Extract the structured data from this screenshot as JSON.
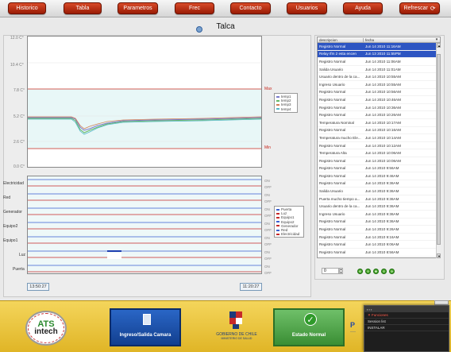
{
  "nav": {
    "buttons": [
      {
        "label": "Historico"
      },
      {
        "label": "Tabla"
      },
      {
        "label": "Parametros"
      },
      {
        "label": "Frec"
      },
      {
        "label": "Contacto"
      },
      {
        "label": "Usuarios"
      },
      {
        "label": "Ayuda"
      },
      {
        "label": "Refrescar",
        "icon": "refresh-icon"
      }
    ]
  },
  "page": {
    "title": "Talca"
  },
  "temp_chart": {
    "y_ticks": [
      "12.0 C°",
      "10.4 C°",
      "7.8 C°",
      "5.2 C°",
      "2.6 C°",
      "0.0 C°"
    ],
    "limit_max_label": "Max",
    "limit_min_label": "Min",
    "legend": [
      "temp1",
      "temp2",
      "temp3",
      "temp4"
    ]
  },
  "signals_chart": {
    "labels": [
      "Electricidad",
      "Red",
      "Generador",
      "Equipo2",
      "Equipo1",
      "Luz",
      "Puerta"
    ],
    "on_label": "ON",
    "off_label": "OFF",
    "legend": [
      "Puerta",
      "Luz",
      "Equipo1",
      "Equipo2",
      "Generador",
      "Red",
      "Electricidad"
    ]
  },
  "time_range": {
    "start": "13:50:27",
    "end": "11:20:27"
  },
  "event_table": {
    "col_description": "descripcion",
    "col_date": "fecha",
    "rows": [
      {
        "desc": "Registro Normal",
        "date": "Jun 14 2010 11:16AM",
        "selected": true
      },
      {
        "desc": "Relay Ifm 2 esta encen",
        "date": "Jun 13 2010 11:55PM",
        "selected": true
      },
      {
        "desc": "Registro Normal",
        "date": "Jun 14 2010 11:06AM",
        "selected": false
      },
      {
        "desc": "Salida Usuario",
        "date": "Jun 14 2010 11:01AM",
        "selected": false
      },
      {
        "desc": "Usuario dentro de la ca...",
        "date": "Jun 14 2010 10:55AM",
        "selected": false
      },
      {
        "desc": "Ingreso Usuario",
        "date": "Jun 14 2010 10:55AM",
        "selected": false
      },
      {
        "desc": "Registro Normal",
        "date": "Jun 14 2010 10:56AM",
        "selected": false
      },
      {
        "desc": "Registro Normal",
        "date": "Jun 14 2010 10:46AM",
        "selected": false
      },
      {
        "desc": "Registro Normal",
        "date": "Jun 14 2010 10:36AM",
        "selected": false
      },
      {
        "desc": "Registro Normal",
        "date": "Jun 14 2010 10:26AM",
        "selected": false
      },
      {
        "desc": "Temperatura Nominal",
        "date": "Jun 14 2010 10:17AM",
        "selected": false
      },
      {
        "desc": "Registro Normal",
        "date": "Jun 14 2010 10:16AM",
        "selected": false
      },
      {
        "desc": "Temperatura mucho Ele...",
        "date": "Jun 14 2010 10:14AM",
        "selected": false
      },
      {
        "desc": "Registro Normal",
        "date": "Jun 14 2010 10:12AM",
        "selected": false
      },
      {
        "desc": "Temperatura Alta",
        "date": "Jun 14 2010 10:06AM",
        "selected": false
      },
      {
        "desc": "Registro Normal",
        "date": "Jun 14 2010 10:06AM",
        "selected": false
      },
      {
        "desc": "Registro Normal",
        "date": "Jun 14 2010 9:56AM",
        "selected": false
      },
      {
        "desc": "Registro Normal",
        "date": "Jun 14 2010 9:46AM",
        "selected": false
      },
      {
        "desc": "Registro Normal",
        "date": "Jun 14 2010 9:36AM",
        "selected": false
      },
      {
        "desc": "Salida Usuario",
        "date": "Jun 14 2010 9:36AM",
        "selected": false
      },
      {
        "desc": "Puerta mucho tiempo a...",
        "date": "Jun 14 2010 9:36AM",
        "selected": false
      },
      {
        "desc": "Usuario dentro de la ca...",
        "date": "Jun 14 2010 9:36AM",
        "selected": false
      },
      {
        "desc": "Ingreso Usuario",
        "date": "Jun 14 2010 9:36AM",
        "selected": false
      },
      {
        "desc": "Registro Normal",
        "date": "Jun 14 2010 9:36AM",
        "selected": false
      },
      {
        "desc": "Registro Normal",
        "date": "Jun 14 2010 9:26AM",
        "selected": false
      },
      {
        "desc": "Registro Normal",
        "date": "Jun 14 2010 9:16AM",
        "selected": false
      },
      {
        "desc": "Registro Normal",
        "date": "Jun 14 2010 9:06AM",
        "selected": false
      },
      {
        "desc": "Registro Normal",
        "date": "Jun 14 2010 8:56AM",
        "selected": false
      },
      {
        "desc": "Registro Normal",
        "date": "Jun 14 2010 8:46AM",
        "selected": false
      }
    ]
  },
  "pager": {
    "page": "0"
  },
  "bottom": {
    "logo": {
      "line1": "ATS",
      "line2": "intech"
    },
    "ingreso_label": "Ingreso/Salida Camara",
    "gob_line1": "GOBIERNO DE CHILE",
    "gob_line2": "MINISTERIO DE SALUD",
    "estado_label": "Estado Normal",
    "popup": {
      "line1": "Funciones",
      "line2": "Session list",
      "line3": "INSTALAR"
    }
  },
  "colors": {
    "nav_red": "#b52c0f",
    "temp_series": [
      "#7a7acb",
      "#66b866",
      "#d07f56",
      "#56b8c8"
    ],
    "limit_line": "#c8281e",
    "signal_on": "#3a5fd0",
    "signal_off": "#c62a2a"
  }
}
